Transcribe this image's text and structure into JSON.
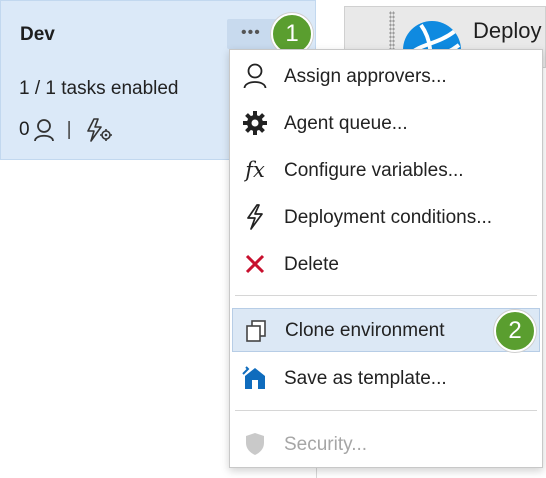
{
  "environment": {
    "name": "Dev",
    "tasks": "1 / 1 tasks enabled",
    "approvers_count": "0",
    "separator": "|"
  },
  "more_button": {
    "label": "•••"
  },
  "badges": {
    "first": "1",
    "second": "2"
  },
  "right_panel": {
    "title": "Deploy"
  },
  "menu": {
    "items": [
      {
        "label": "Assign approvers...",
        "icon": "person-icon"
      },
      {
        "label": "Agent queue...",
        "icon": "gear-icon"
      },
      {
        "label": "Configure variables...",
        "icon": "fx-icon"
      },
      {
        "label": "Deployment conditions...",
        "icon": "lightning-icon"
      },
      {
        "label": "Delete",
        "icon": "close-icon"
      },
      {
        "label": "Clone environment",
        "icon": "clone-icon"
      },
      {
        "label": "Save as template...",
        "icon": "template-icon"
      },
      {
        "label": "Security...",
        "icon": "shield-icon"
      }
    ],
    "fx_glyph": "fx"
  },
  "colors": {
    "card_bg": "#dbe9f8",
    "highlight_bg": "#dce8f5",
    "badge": "#5a9e2f",
    "delete_red": "#c8102e",
    "template_blue": "#0f6cbd",
    "disabled": "#a6a6a6"
  }
}
